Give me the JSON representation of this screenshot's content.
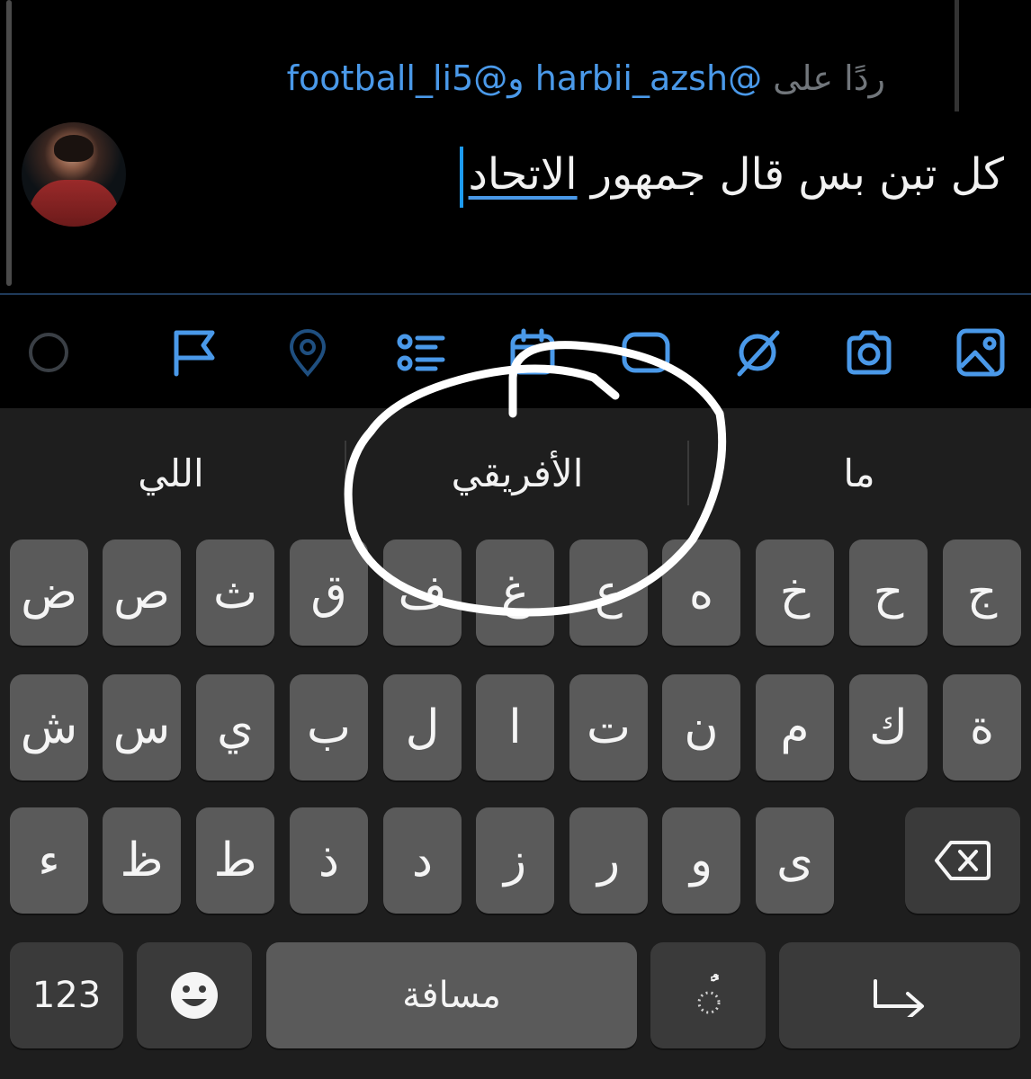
{
  "compose": {
    "reply_prefix": "ردًا على",
    "mention_1": "@harbii_azsh",
    "joiner": "و",
    "mention_2": "@football_li5",
    "text_before": "كل تبن بس قال جمهور",
    "text_highlight": "الاتحاد"
  },
  "toolbar": {
    "icons": [
      "image-icon",
      "camera-icon",
      "gif-icon",
      "poll-icon",
      "schedule-icon",
      "list-icon",
      "location-icon",
      "flag-icon",
      "character-count-ring"
    ],
    "accent_color": "#4a99e9"
  },
  "keyboard": {
    "suggestions": [
      "ما",
      "الأفريقي",
      "اللي"
    ],
    "row1": [
      "ج",
      "ح",
      "خ",
      "ه",
      "ع",
      "غ",
      "ف",
      "ق",
      "ث",
      "ص",
      "ض"
    ],
    "row2": [
      "ة",
      "ك",
      "م",
      "ن",
      "ت",
      "ا",
      "ل",
      "ب",
      "ي",
      "س",
      "ش"
    ],
    "row3": [
      "ى",
      "و",
      "ر",
      "ز",
      "د",
      "ذ",
      "ط",
      "ظ",
      "ء"
    ],
    "numbers_label": "123",
    "space_label": "مسافة",
    "diacritic_label": "ًٌ",
    "backspace_icon": "backspace-icon",
    "return_icon": "return-icon",
    "emoji_icon": "emoji-icon"
  },
  "annotation": {
    "type": "hand-drawn circle",
    "target": "suggestion الأفريقي",
    "color": "#ffffff"
  }
}
